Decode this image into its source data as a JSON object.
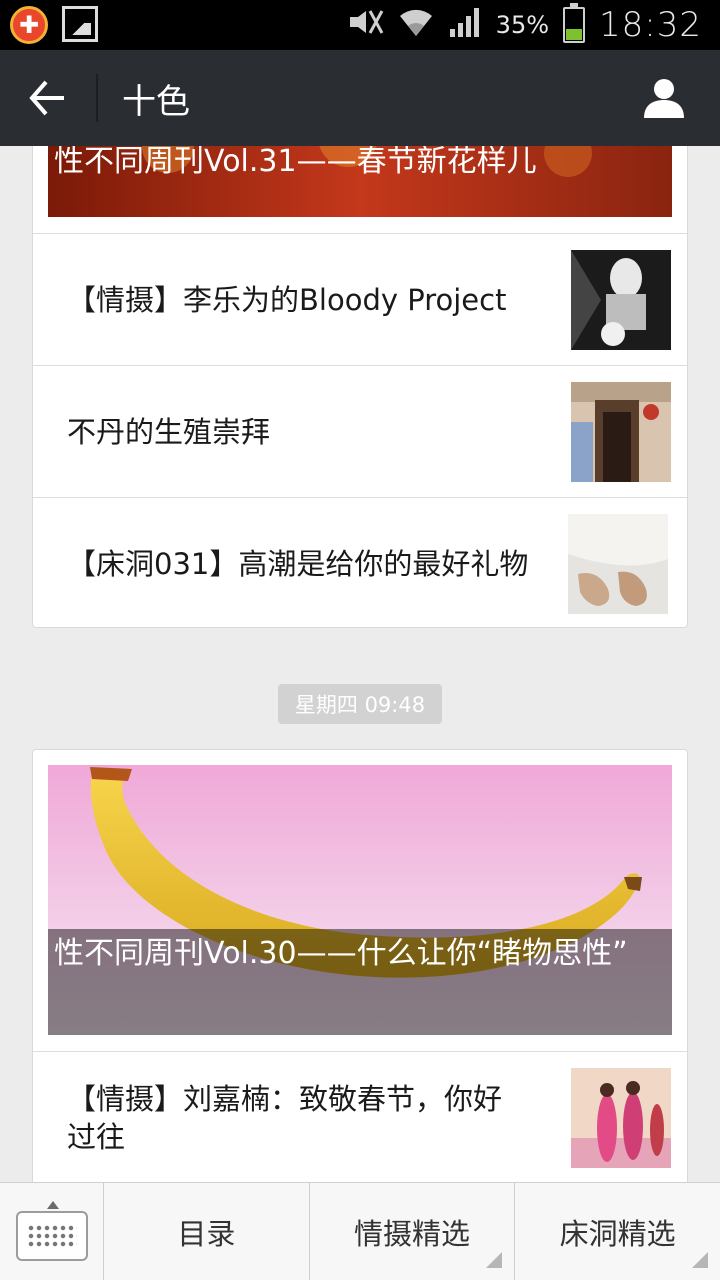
{
  "status_bar": {
    "battery_percent": "35%",
    "battery_level": 0.35,
    "time": "18:32",
    "icons": [
      "app-notification-icon",
      "image-icon",
      "mute-icon",
      "wifi-icon",
      "signal-icon",
      "battery-icon"
    ]
  },
  "action_bar": {
    "title": "十色",
    "back_icon": "back-arrow-icon",
    "profile_icon": "person-icon"
  },
  "feed": {
    "group1": {
      "cover_title": "性不同周刊Vol.31——春节新花样儿",
      "items": [
        {
          "title": "【情摄】李乐为的Bloody Project"
        },
        {
          "title": "不丹的生殖崇拜"
        },
        {
          "title": "【床洞031】高潮是给你的最好礼物"
        }
      ]
    },
    "timestamp": "星期四 09:48",
    "group2": {
      "cover_title": "性不同周刊Vol.30——什么让你“睹物思性”",
      "items": [
        {
          "title": "【情摄】刘嘉楠：致敬春节，你好过往"
        }
      ]
    }
  },
  "bottom_menu": {
    "keyboard_icon": "keyboard-icon",
    "items": [
      {
        "label": "目录"
      },
      {
        "label": "情摄精选"
      },
      {
        "label": "床洞精选"
      }
    ]
  },
  "colors": {
    "action_bar_bg": "#2a2d32",
    "status_bar_bg": "#000000",
    "page_bg": "#ececec",
    "battery_green": "#7dc12e"
  }
}
